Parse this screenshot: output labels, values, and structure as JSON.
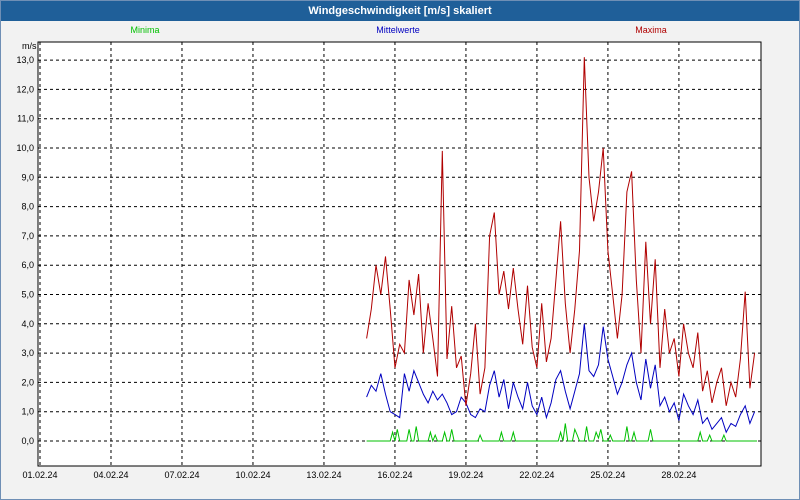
{
  "window": {
    "title": "Windgeschwindigkeit [m/s] skaliert"
  },
  "colors": {
    "minima": "#00c000",
    "mittelwerte": "#0000c0",
    "maxima": "#b00000",
    "titlebar": "#1f5f99"
  },
  "chart_data": {
    "type": "line",
    "title": "Windgeschwindigkeit [m/s] skaliert",
    "ylabel": "m/s",
    "xlabel": "",
    "ylim": [
      0,
      13.5
    ],
    "xlim": [
      0,
      30.3
    ],
    "grid": true,
    "legend_placement": "top",
    "y_ticks": [
      "0,0",
      "1,0",
      "2,0",
      "3,0",
      "4,0",
      "5,0",
      "6,0",
      "7,0",
      "8,0",
      "9,0",
      "10,0",
      "11,0",
      "12,0",
      "13,0"
    ],
    "x_tick_labels": [
      "01.02.24",
      "04.02.24",
      "07.02.24",
      "10.02.24",
      "13.02.24",
      "16.02.24",
      "19.02.24",
      "22.02.24",
      "25.02.24",
      "28.02.24"
    ],
    "x_tick_days": [
      0,
      3,
      6,
      9,
      12,
      15,
      18,
      21,
      24,
      27
    ],
    "series": [
      {
        "name": "Minima",
        "color": "#00c000",
        "points": [
          [
            13.8,
            0
          ],
          [
            14.8,
            0
          ],
          [
            14.9,
            0.3
          ],
          [
            15.0,
            0
          ],
          [
            15.1,
            0.4
          ],
          [
            15.2,
            0
          ],
          [
            15.5,
            0
          ],
          [
            15.6,
            0.4
          ],
          [
            15.7,
            0
          ],
          [
            15.8,
            0
          ],
          [
            15.9,
            0.5
          ],
          [
            16.0,
            0
          ],
          [
            16.4,
            0
          ],
          [
            16.5,
            0.3
          ],
          [
            16.6,
            0
          ],
          [
            16.7,
            0.2
          ],
          [
            16.8,
            0
          ],
          [
            17.0,
            0
          ],
          [
            17.1,
            0.3
          ],
          [
            17.2,
            0
          ],
          [
            17.3,
            0
          ],
          [
            17.4,
            0.4
          ],
          [
            17.5,
            0
          ],
          [
            18.5,
            0
          ],
          [
            18.6,
            0.2
          ],
          [
            18.7,
            0
          ],
          [
            19.4,
            0
          ],
          [
            19.5,
            0.3
          ],
          [
            19.6,
            0
          ],
          [
            19.9,
            0
          ],
          [
            20.0,
            0.3
          ],
          [
            20.1,
            0
          ],
          [
            21.9,
            0
          ],
          [
            22.0,
            0.3
          ],
          [
            22.1,
            0
          ],
          [
            22.2,
            0.6
          ],
          [
            22.3,
            0
          ],
          [
            22.5,
            0
          ],
          [
            22.6,
            0.4
          ],
          [
            22.7,
            0.2
          ],
          [
            22.8,
            0
          ],
          [
            23.0,
            0
          ],
          [
            23.1,
            0.5
          ],
          [
            23.2,
            0
          ],
          [
            23.4,
            0
          ],
          [
            23.5,
            0.3
          ],
          [
            23.6,
            0.1
          ],
          [
            23.7,
            0.4
          ],
          [
            23.8,
            0
          ],
          [
            24.0,
            0
          ],
          [
            24.1,
            0.2
          ],
          [
            24.2,
            0
          ],
          [
            24.7,
            0
          ],
          [
            24.8,
            0.5
          ],
          [
            24.9,
            0
          ],
          [
            25.0,
            0
          ],
          [
            25.1,
            0.3
          ],
          [
            25.2,
            0
          ],
          [
            25.7,
            0
          ],
          [
            25.8,
            0.4
          ],
          [
            25.9,
            0
          ],
          [
            27.8,
            0
          ],
          [
            27.9,
            0.3
          ],
          [
            28.0,
            0
          ],
          [
            28.2,
            0
          ],
          [
            28.3,
            0.2
          ],
          [
            28.4,
            0
          ],
          [
            28.8,
            0
          ],
          [
            28.9,
            0.2
          ],
          [
            29.0,
            0
          ],
          [
            30.3,
            0
          ]
        ]
      },
      {
        "name": "Mittelwerte",
        "color": "#0000c0",
        "points": [
          [
            13.8,
            1.5
          ],
          [
            14.0,
            1.9
          ],
          [
            14.2,
            1.7
          ],
          [
            14.4,
            2.3
          ],
          [
            14.6,
            1.6
          ],
          [
            14.8,
            1.0
          ],
          [
            15.0,
            0.9
          ],
          [
            15.2,
            0.8
          ],
          [
            15.4,
            2.3
          ],
          [
            15.6,
            1.7
          ],
          [
            15.8,
            2.4
          ],
          [
            16.0,
            2.0
          ],
          [
            16.2,
            1.6
          ],
          [
            16.4,
            1.3
          ],
          [
            16.6,
            1.7
          ],
          [
            16.8,
            1.4
          ],
          [
            17.0,
            1.6
          ],
          [
            17.2,
            1.3
          ],
          [
            17.4,
            0.9
          ],
          [
            17.6,
            1.0
          ],
          [
            17.8,
            1.5
          ],
          [
            18.0,
            1.3
          ],
          [
            18.2,
            0.9
          ],
          [
            18.4,
            0.8
          ],
          [
            18.6,
            1.1
          ],
          [
            18.8,
            1.0
          ],
          [
            19.0,
            1.9
          ],
          [
            19.2,
            2.4
          ],
          [
            19.4,
            1.5
          ],
          [
            19.6,
            2.1
          ],
          [
            19.8,
            1.1
          ],
          [
            20.0,
            2.0
          ],
          [
            20.2,
            1.5
          ],
          [
            20.4,
            1.1
          ],
          [
            20.6,
            2.0
          ],
          [
            20.8,
            1.2
          ],
          [
            21.0,
            0.9
          ],
          [
            21.2,
            1.5
          ],
          [
            21.4,
            0.8
          ],
          [
            21.6,
            1.3
          ],
          [
            21.8,
            2.1
          ],
          [
            22.0,
            2.4
          ],
          [
            22.2,
            1.7
          ],
          [
            22.4,
            1.1
          ],
          [
            22.6,
            1.7
          ],
          [
            22.8,
            2.3
          ],
          [
            23.0,
            4.0
          ],
          [
            23.2,
            2.4
          ],
          [
            23.4,
            2.2
          ],
          [
            23.6,
            2.6
          ],
          [
            23.8,
            3.9
          ],
          [
            24.0,
            2.8
          ],
          [
            24.2,
            2.2
          ],
          [
            24.4,
            1.6
          ],
          [
            24.6,
            2.0
          ],
          [
            24.8,
            2.6
          ],
          [
            25.0,
            3.0
          ],
          [
            25.2,
            2.0
          ],
          [
            25.4,
            1.4
          ],
          [
            25.6,
            2.8
          ],
          [
            25.8,
            1.8
          ],
          [
            26.0,
            2.6
          ],
          [
            26.2,
            1.2
          ],
          [
            26.4,
            1.5
          ],
          [
            26.6,
            1.0
          ],
          [
            26.8,
            1.3
          ],
          [
            27.0,
            0.7
          ],
          [
            27.2,
            1.6
          ],
          [
            27.4,
            1.2
          ],
          [
            27.6,
            0.9
          ],
          [
            27.8,
            1.4
          ],
          [
            28.0,
            0.6
          ],
          [
            28.2,
            0.8
          ],
          [
            28.4,
            0.4
          ],
          [
            28.6,
            0.6
          ],
          [
            28.8,
            0.8
          ],
          [
            29.0,
            0.3
          ],
          [
            29.2,
            0.6
          ],
          [
            29.4,
            0.5
          ],
          [
            29.6,
            0.9
          ],
          [
            29.8,
            1.2
          ],
          [
            30.0,
            0.6
          ],
          [
            30.2,
            1.0
          ]
        ]
      },
      {
        "name": "Maxima",
        "color": "#b00000",
        "points": [
          [
            13.8,
            3.5
          ],
          [
            14.0,
            4.5
          ],
          [
            14.2,
            6.0
          ],
          [
            14.4,
            5.0
          ],
          [
            14.6,
            6.3
          ],
          [
            14.8,
            4.5
          ],
          [
            15.0,
            2.5
          ],
          [
            15.2,
            3.3
          ],
          [
            15.4,
            3.0
          ],
          [
            15.6,
            5.5
          ],
          [
            15.8,
            4.3
          ],
          [
            16.0,
            5.7
          ],
          [
            16.2,
            3.0
          ],
          [
            16.4,
            4.7
          ],
          [
            16.6,
            3.5
          ],
          [
            16.8,
            2.2
          ],
          [
            17.0,
            9.9
          ],
          [
            17.2,
            2.8
          ],
          [
            17.4,
            4.6
          ],
          [
            17.6,
            2.5
          ],
          [
            17.8,
            2.9
          ],
          [
            18.0,
            1.2
          ],
          [
            18.2,
            2.3
          ],
          [
            18.4,
            4.0
          ],
          [
            18.6,
            1.6
          ],
          [
            18.8,
            2.5
          ],
          [
            19.0,
            7.0
          ],
          [
            19.2,
            7.8
          ],
          [
            19.4,
            5.0
          ],
          [
            19.6,
            5.8
          ],
          [
            19.8,
            4.5
          ],
          [
            20.0,
            5.9
          ],
          [
            20.2,
            4.5
          ],
          [
            20.4,
            3.3
          ],
          [
            20.6,
            5.3
          ],
          [
            20.8,
            3.2
          ],
          [
            21.0,
            2.5
          ],
          [
            21.2,
            4.7
          ],
          [
            21.4,
            2.7
          ],
          [
            21.6,
            3.5
          ],
          [
            21.8,
            5.5
          ],
          [
            22.0,
            7.5
          ],
          [
            22.2,
            4.7
          ],
          [
            22.4,
            3.0
          ],
          [
            22.6,
            4.5
          ],
          [
            22.8,
            6.5
          ],
          [
            23.0,
            13.1
          ],
          [
            23.2,
            9.0
          ],
          [
            23.4,
            7.5
          ],
          [
            23.6,
            8.5
          ],
          [
            23.8,
            10.0
          ],
          [
            24.0,
            6.5
          ],
          [
            24.2,
            5.0
          ],
          [
            24.4,
            3.5
          ],
          [
            24.6,
            5.0
          ],
          [
            24.8,
            8.5
          ],
          [
            25.0,
            9.2
          ],
          [
            25.2,
            5.5
          ],
          [
            25.4,
            3.0
          ],
          [
            25.6,
            6.8
          ],
          [
            25.8,
            4.0
          ],
          [
            26.0,
            6.2
          ],
          [
            26.2,
            2.5
          ],
          [
            26.4,
            4.5
          ],
          [
            26.6,
            3.0
          ],
          [
            26.8,
            3.5
          ],
          [
            27.0,
            2.2
          ],
          [
            27.2,
            4.0
          ],
          [
            27.4,
            3.0
          ],
          [
            27.6,
            2.5
          ],
          [
            27.8,
            3.7
          ],
          [
            28.0,
            1.7
          ],
          [
            28.2,
            2.4
          ],
          [
            28.4,
            1.3
          ],
          [
            28.6,
            2.0
          ],
          [
            28.8,
            2.5
          ],
          [
            29.0,
            1.2
          ],
          [
            29.2,
            2.0
          ],
          [
            29.4,
            1.5
          ],
          [
            29.6,
            2.8
          ],
          [
            29.8,
            5.1
          ],
          [
            30.0,
            1.8
          ],
          [
            30.2,
            3.0
          ]
        ]
      }
    ]
  }
}
